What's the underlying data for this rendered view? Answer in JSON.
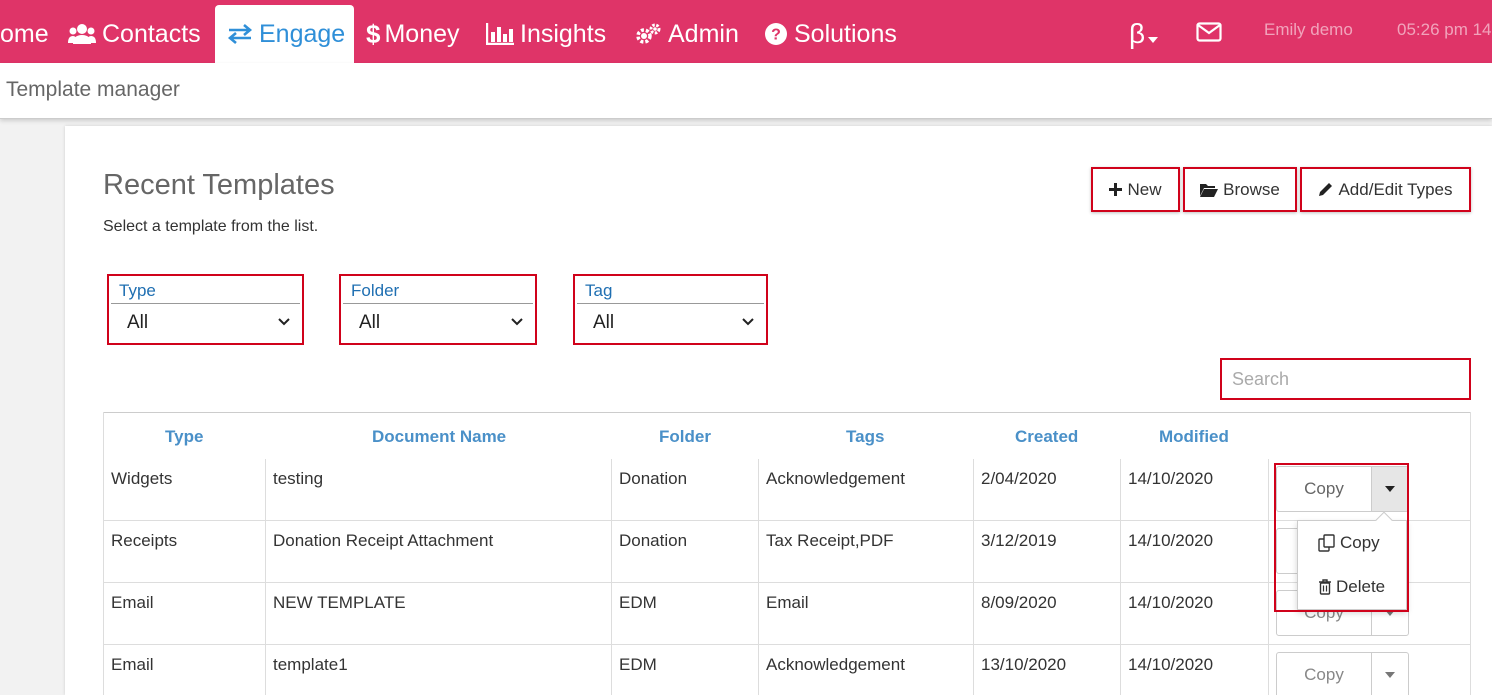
{
  "nav": {
    "home_label": "ome",
    "contacts_label": "Contacts",
    "engage_label": "Engage",
    "money_label": "Money",
    "insights_label": "Insights",
    "admin_label": "Admin",
    "solutions_label": "Solutions",
    "beta_label": "β",
    "user_name": "Emily demo",
    "time": "05:26 pm 14",
    "active": "Engage"
  },
  "breadcrumb": {
    "title": "Template manager"
  },
  "page": {
    "title": "Recent Templates",
    "subtitle": "Select a template from the list."
  },
  "header_buttons": {
    "new": "New",
    "browse": "Browse",
    "add_edit_types": "Add/Edit Types"
  },
  "filters": [
    {
      "label": "Type",
      "value": "All"
    },
    {
      "label": "Folder",
      "value": "All"
    },
    {
      "label": "Tag",
      "value": "All"
    }
  ],
  "search": {
    "placeholder": "Search"
  },
  "table": {
    "columns": [
      "Type",
      "Document Name",
      "Folder",
      "Tags",
      "Created",
      "Modified"
    ],
    "rows": [
      {
        "type": "Widgets",
        "name": "testing",
        "folder": "Donation",
        "tags": "Acknowledgement",
        "created": "2/04/2020",
        "modified": "14/10/2020",
        "action": "Copy"
      },
      {
        "type": "Receipts",
        "name": "Donation Receipt Attachment",
        "folder": "Donation",
        "tags": "Tax Receipt,PDF",
        "created": "3/12/2019",
        "modified": "14/10/2020",
        "action": "Copy"
      },
      {
        "type": "Email",
        "name": "NEW TEMPLATE",
        "folder": "EDM",
        "tags": "Email",
        "created": "8/09/2020",
        "modified": "14/10/2020",
        "action": "Copy"
      },
      {
        "type": "Email",
        "name": "template1",
        "folder": "EDM",
        "tags": "Acknowledgement",
        "created": "13/10/2020",
        "modified": "14/10/2020",
        "action": "Copy"
      }
    ]
  },
  "row_menu": {
    "copy": "Copy",
    "delete": "Delete"
  },
  "colors": {
    "nav_bg": "#df3468",
    "accent_blue": "#2f8fd8",
    "highlight_red": "#d0021b",
    "header_text": "#4a90c8"
  }
}
